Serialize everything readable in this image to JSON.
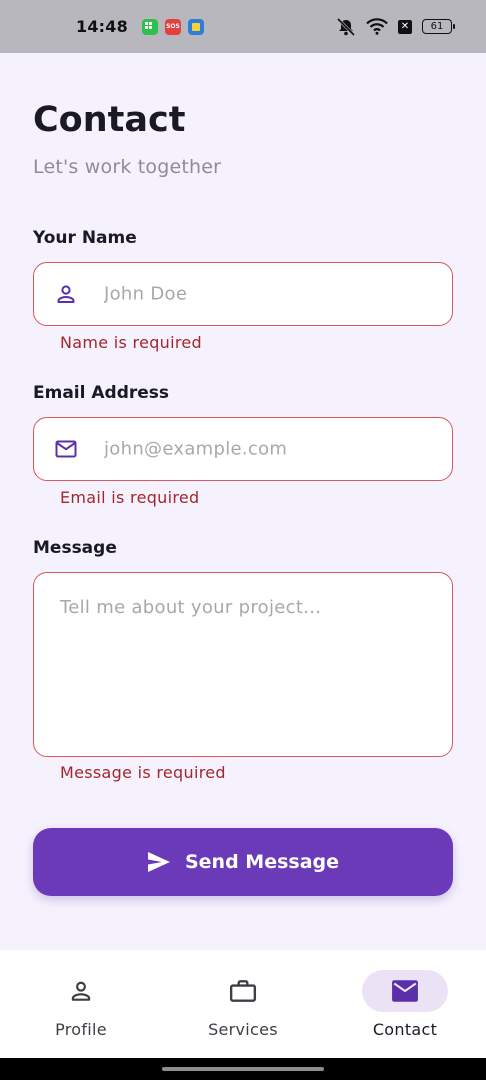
{
  "status_bar": {
    "time": "14:48",
    "app_icons": [
      {
        "name": "grid-app-icon",
        "color": "#2fc04b"
      },
      {
        "name": "sos-app-icon",
        "color": "#e5403e",
        "label": "SOS"
      },
      {
        "name": "notes-app-icon",
        "color": "#2c7fd6"
      }
    ],
    "battery": "61"
  },
  "page": {
    "title": "Contact",
    "subtitle": "Let's work together"
  },
  "form": {
    "name": {
      "label": "Your Name",
      "placeholder": "John Doe",
      "value": "",
      "error": "Name is required",
      "icon": "person-icon"
    },
    "email": {
      "label": "Email Address",
      "placeholder": "john@example.com",
      "value": "",
      "error": "Email is required",
      "icon": "mail-icon"
    },
    "message": {
      "label": "Message",
      "placeholder": "Tell me about your project...",
      "value": "",
      "error": "Message is required"
    },
    "submit_label": "Send Message"
  },
  "bottom_nav": {
    "items": [
      {
        "label": "Profile",
        "icon": "person-icon",
        "active": false
      },
      {
        "label": "Services",
        "icon": "briefcase-icon",
        "active": false
      },
      {
        "label": "Contact",
        "icon": "mail-icon",
        "active": true
      }
    ]
  },
  "colors": {
    "accent": "#6a3ab8",
    "error": "#a3272c",
    "error_border": "#d9575c",
    "background": "#f6f2fd"
  }
}
